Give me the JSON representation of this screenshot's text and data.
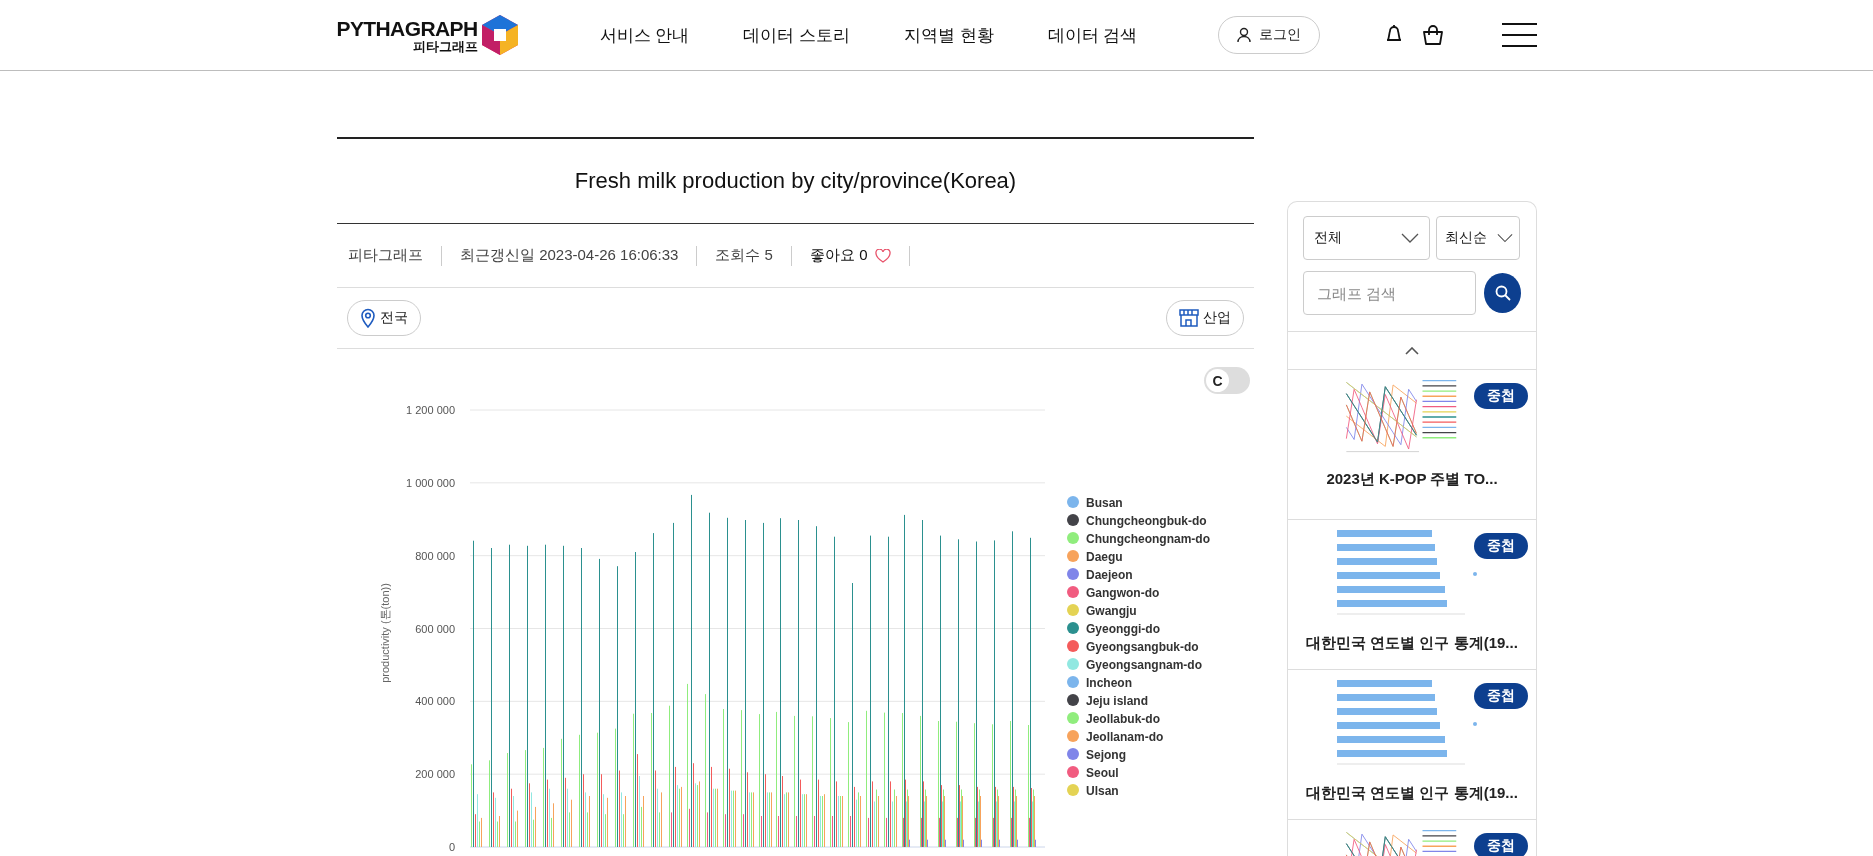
{
  "header": {
    "logo": {
      "wordmark": "PYTHAGRAPH",
      "subtitle": "피타그래프"
    },
    "nav": [
      "서비스 안내",
      "데이터 스토리",
      "지역별 현황",
      "데이터 검색"
    ],
    "login": "로그인"
  },
  "article": {
    "title": "Fresh milk production by city/province(Korea)",
    "meta": [
      {
        "kind": "text",
        "text": "피타그래프"
      },
      {
        "kind": "text",
        "text": "최근갱신일 2023-04-26 16:06:33"
      },
      {
        "kind": "text",
        "text": "조회수 5"
      },
      {
        "kind": "like",
        "text": "좋아요 0",
        "liked": false
      }
    ],
    "region_button": "전국",
    "category_button": "산업"
  },
  "chart": {
    "toggle": {
      "label": "C",
      "on": false
    },
    "chart_data": {
      "type": "bar",
      "stacked": false,
      "grid": true,
      "legend": "right",
      "ylabel": "productivity (톤(ton))",
      "ylim": [
        0,
        1200000
      ],
      "yticks": [
        {
          "value": 0,
          "label": "0"
        },
        {
          "value": 200000,
          "label": "200 000"
        },
        {
          "value": 400000,
          "label": "400 000"
        },
        {
          "value": 600000,
          "label": "600 000"
        },
        {
          "value": 800000,
          "label": "800 000"
        },
        {
          "value": 1000000,
          "label": "1 000 000"
        },
        {
          "value": 1200000,
          "label": "1 200 000"
        }
      ],
      "series": [
        {
          "name": "Busan",
          "color": "#7cb5ec",
          "values": [
            null,
            null,
            null,
            null,
            null,
            null,
            null,
            null,
            null,
            null,
            null,
            null,
            null,
            null,
            null,
            null,
            null,
            null,
            null,
            null,
            null,
            null,
            null,
            null,
            null,
            null,
            null,
            null,
            null,
            null,
            null,
            null
          ]
        },
        {
          "name": "Chungcheongbuk-do",
          "color": "#434348",
          "values": [
            null,
            null,
            null,
            null,
            null,
            null,
            null,
            null,
            null,
            null,
            null,
            null,
            null,
            null,
            null,
            null,
            null,
            null,
            null,
            null,
            null,
            null,
            null,
            null,
            null,
            null,
            null,
            null,
            null,
            null,
            null,
            null
          ]
        },
        {
          "name": "Chungcheongnam-do",
          "color": "#90ed7d",
          "values": [
            227000,
            238000,
            258000,
            266000,
            272000,
            297000,
            308000,
            314000,
            325000,
            366000,
            368000,
            388000,
            448000,
            420000,
            379000,
            376000,
            365000,
            371000,
            360000,
            359000,
            354000,
            343000,
            374000,
            369000,
            368000,
            360000,
            346000,
            344000,
            340000,
            337000,
            346000,
            335000
          ]
        },
        {
          "name": "Daegu",
          "color": "#f7a35c",
          "values": [
            null,
            null,
            null,
            null,
            null,
            null,
            null,
            null,
            null,
            null,
            null,
            null,
            null,
            null,
            null,
            null,
            null,
            null,
            null,
            null,
            null,
            null,
            null,
            null,
            null,
            null,
            null,
            null,
            null,
            null,
            null,
            null
          ]
        },
        {
          "name": "Daejeon",
          "color": "#8085e9",
          "values": [
            null,
            null,
            null,
            null,
            null,
            null,
            null,
            null,
            null,
            null,
            null,
            null,
            null,
            null,
            null,
            null,
            null,
            null,
            null,
            null,
            null,
            null,
            null,
            null,
            null,
            null,
            null,
            null,
            null,
            null,
            null,
            null
          ]
        },
        {
          "name": "Gangwon-do",
          "color": "#f15c80",
          "values": [
            null,
            null,
            null,
            null,
            null,
            null,
            null,
            null,
            null,
            null,
            null,
            95000,
            105000,
            95000,
            90000,
            90000,
            85000,
            85000,
            85000,
            85000,
            85000,
            85000,
            80000,
            80000,
            80000,
            80000,
            80000,
            80000,
            80000,
            80000,
            80000,
            80000
          ]
        },
        {
          "name": "Gwangju",
          "color": "#e4d354",
          "values": [
            null,
            null,
            null,
            null,
            null,
            null,
            null,
            null,
            null,
            null,
            null,
            null,
            null,
            null,
            null,
            null,
            null,
            null,
            null,
            null,
            null,
            null,
            null,
            null,
            null,
            null,
            null,
            null,
            null,
            null,
            null,
            null
          ]
        },
        {
          "name": "Gyeonggi-do",
          "color": "#2b908f",
          "values": [
            841000,
            821000,
            830000,
            827000,
            830000,
            827000,
            821000,
            791000,
            771000,
            810000,
            862000,
            890000,
            967000,
            918000,
            904000,
            898000,
            890000,
            903000,
            898000,
            881000,
            852000,
            725000,
            855000,
            852000,
            912000,
            898000,
            855000,
            845000,
            839000,
            842000,
            867000,
            849000
          ]
        },
        {
          "name": "Gyeongsangbuk-do",
          "color": "#f45b5b",
          "values": [
            90000,
            150000,
            160000,
            175000,
            185000,
            190000,
            200000,
            200000,
            210000,
            255000,
            210000,
            220000,
            230000,
            220000,
            215000,
            205000,
            200000,
            195000,
            185000,
            185000,
            180000,
            165000,
            180000,
            180000,
            185000,
            180000,
            170000,
            170000,
            165000,
            165000,
            165000,
            162000
          ]
        },
        {
          "name": "Gyeongsangnam-do",
          "color": "#91e8e1",
          "values": [
            145000,
            135000,
            140000,
            150000,
            160000,
            160000,
            150000,
            145000,
            150000,
            195000,
            160000,
            170000,
            175000,
            160000,
            155000,
            150000,
            150000,
            145000,
            145000,
            140000,
            140000,
            130000,
            125000,
            125000,
            125000,
            125000,
            125000,
            125000,
            125000,
            125000,
            125000,
            125000
          ]
        },
        {
          "name": "Incheon",
          "color": "#7cb5ec",
          "values": [
            null,
            null,
            null,
            null,
            null,
            null,
            null,
            null,
            null,
            null,
            null,
            null,
            null,
            null,
            null,
            null,
            null,
            null,
            null,
            null,
            null,
            null,
            null,
            null,
            null,
            null,
            null,
            null,
            null,
            null,
            null,
            null
          ]
        },
        {
          "name": "Jeju island",
          "color": "#434348",
          "values": [
            null,
            null,
            null,
            null,
            null,
            null,
            null,
            null,
            null,
            null,
            null,
            null,
            null,
            null,
            null,
            null,
            null,
            null,
            null,
            null,
            null,
            null,
            null,
            null,
            null,
            null,
            null,
            null,
            null,
            null,
            null,
            null
          ]
        },
        {
          "name": "Jeollabuk-do",
          "color": "#90ed7d",
          "values": [
            70000,
            70000,
            70000,
            75000,
            80000,
            95000,
            95000,
            90000,
            90000,
            110000,
            95000,
            160000,
            170000,
            160000,
            155000,
            150000,
            150000,
            150000,
            145000,
            140000,
            140000,
            150000,
            158000,
            158000,
            158000,
            158000,
            158000,
            158000,
            158000,
            158000,
            158000,
            158000
          ]
        },
        {
          "name": "Jeollanam-do",
          "color": "#f7a35c",
          "values": [
            80000,
            85000,
            100000,
            110000,
            120000,
            130000,
            140000,
            135000,
            140000,
            140000,
            150000,
            165000,
            180000,
            160000,
            155000,
            150000,
            150000,
            150000,
            145000,
            145000,
            140000,
            140000,
            140000,
            140000,
            140000,
            140000,
            140000,
            140000,
            140000,
            140000,
            140000,
            140000
          ]
        },
        {
          "name": "Sejong",
          "color": "#8085e9",
          "values": [
            null,
            null,
            null,
            null,
            null,
            null,
            null,
            null,
            null,
            null,
            null,
            null,
            null,
            null,
            null,
            null,
            null,
            null,
            null,
            null,
            null,
            null,
            null,
            null,
            20000,
            20000,
            20000,
            20000,
            20000,
            20000,
            20000,
            20000
          ]
        },
        {
          "name": "Seoul",
          "color": "#f15c80",
          "values": [
            null,
            null,
            null,
            null,
            null,
            null,
            null,
            null,
            null,
            null,
            null,
            null,
            null,
            null,
            null,
            null,
            null,
            null,
            null,
            null,
            null,
            null,
            null,
            null,
            null,
            null,
            null,
            null,
            null,
            null,
            null,
            null
          ]
        },
        {
          "name": "Ulsan",
          "color": "#e4d354",
          "values": [
            null,
            null,
            null,
            null,
            null,
            null,
            null,
            null,
            null,
            null,
            null,
            null,
            null,
            null,
            null,
            null,
            null,
            null,
            null,
            null,
            null,
            null,
            null,
            null,
            null,
            null,
            null,
            null,
            null,
            null,
            null,
            null
          ]
        }
      ]
    }
  },
  "sidebar": {
    "filters": [
      {
        "value": "전체"
      },
      {
        "value": "최신순"
      }
    ],
    "search": {
      "placeholder": "그래프 검색"
    },
    "cards": [
      {
        "kind": "line",
        "title": "2023년 K-POP 주별 TO...",
        "badge": "중첩"
      },
      {
        "kind": "bar",
        "title": "대한민국 연도별 인구 통계(19...",
        "badge": "중첩"
      },
      {
        "kind": "bar",
        "title": "대한민국 연도별 인구 통계(19...",
        "badge": "중첩"
      },
      {
        "kind": "line",
        "badge": "중첩"
      }
    ]
  }
}
